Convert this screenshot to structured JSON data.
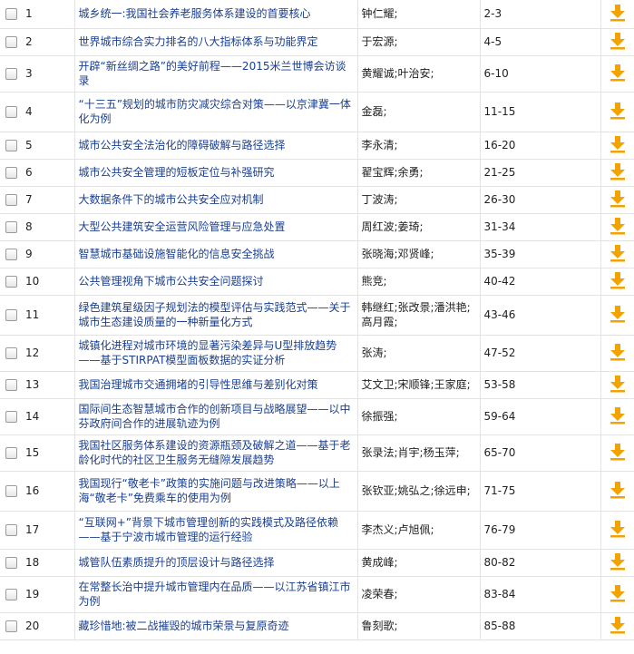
{
  "download_icon": "download-arrow-icon",
  "accent_color": "#f2a300",
  "title_color": "#1a3f8f",
  "rows": [
    {
      "num": "1",
      "title": "城乡统一:我国社会养老服务体系建设的首要核心",
      "authors": "钟仁耀;",
      "pages": "2-3"
    },
    {
      "num": "2",
      "title": "世界城市综合实力排名的八大指标体系与功能界定",
      "authors": "于宏源;",
      "pages": "4-5"
    },
    {
      "num": "3",
      "title": "开辟“新丝绸之路”的美好前程——2015米兰世博会访谈录",
      "authors": "黄耀诚;叶治安;",
      "pages": "6-10"
    },
    {
      "num": "4",
      "title": "“十三五”规划的城市防灾减灾综合对策——以京津冀一体化为例",
      "authors": "金磊;",
      "pages": "11-15"
    },
    {
      "num": "5",
      "title": "城市公共安全法治化的障碍破解与路径选择",
      "authors": "李永清;",
      "pages": "16-20"
    },
    {
      "num": "6",
      "title": "城市公共安全管理的短板定位与补强研究",
      "authors": "翟宝辉;余勇;",
      "pages": "21-25"
    },
    {
      "num": "7",
      "title": "大数据条件下的城市公共安全应对机制",
      "authors": "丁波涛;",
      "pages": "26-30"
    },
    {
      "num": "8",
      "title": "大型公共建筑安全运营风险管理与应急处置",
      "authors": "周红波;姜琦;",
      "pages": "31-34"
    },
    {
      "num": "9",
      "title": "智慧城市基础设施智能化的信息安全挑战",
      "authors": "张晓海;邓贤峰;",
      "pages": "35-39"
    },
    {
      "num": "10",
      "title": "公共管理视角下城市公共安全问题探讨",
      "authors": "熊竞;",
      "pages": "40-42"
    },
    {
      "num": "11",
      "title": "绿色建筑星级因子规划法的模型评估与实践范式——关于城市生态建设质量的一种新量化方式",
      "authors": "韩继红;张改景;潘洪艳;高月霞;",
      "pages": "43-46"
    },
    {
      "num": "12",
      "title": "城镇化进程对城市环境的显著污染差异与U型排放趋势——基于STIRPAT模型面板数据的实证分析",
      "authors": "张涛;",
      "pages": "47-52"
    },
    {
      "num": "13",
      "title": "我国治理城市交通拥堵的引导性思维与差别化对策",
      "authors": "艾文卫;宋顺锋;王家庭;",
      "pages": "53-58"
    },
    {
      "num": "14",
      "title": "国际间生态智慧城市合作的创新项目与战略展望——以中芬政府间合作的进展轨迹为例",
      "authors": "徐振强;",
      "pages": "59-64"
    },
    {
      "num": "15",
      "title": "我国社区服务体系建设的资源瓶颈及破解之道——基于老龄化时代的社区卫生服务无缝隙发展趋势",
      "authors": "张录法;肖宇;杨玉萍;",
      "pages": "65-70"
    },
    {
      "num": "16",
      "title": "我国现行“敬老卡”政策的实施问题与改进策略——以上海“敬老卡”免费乘车的使用为例",
      "authors": "张钦亚;姚弘之;徐远申;",
      "pages": "71-75"
    },
    {
      "num": "17",
      "title": "“互联网+”背景下城市管理创新的实践模式及路径依赖——基于宁波市城市管理的运行经验",
      "authors": "李杰义;卢旭佩;",
      "pages": "76-79"
    },
    {
      "num": "18",
      "title": "城管队伍素质提升的顶层设计与路径选择",
      "authors": "黄成峰;",
      "pages": "80-82"
    },
    {
      "num": "19",
      "title": "在常整长治中提升城市管理内在品质——以江苏省镇江市为例",
      "authors": "凌荣春;",
      "pages": "83-84"
    },
    {
      "num": "20",
      "title": "藏珍惜地:被二战摧毁的城市荣景与复原奇迹",
      "authors": "鲁刻歌;",
      "pages": "85-88"
    }
  ]
}
